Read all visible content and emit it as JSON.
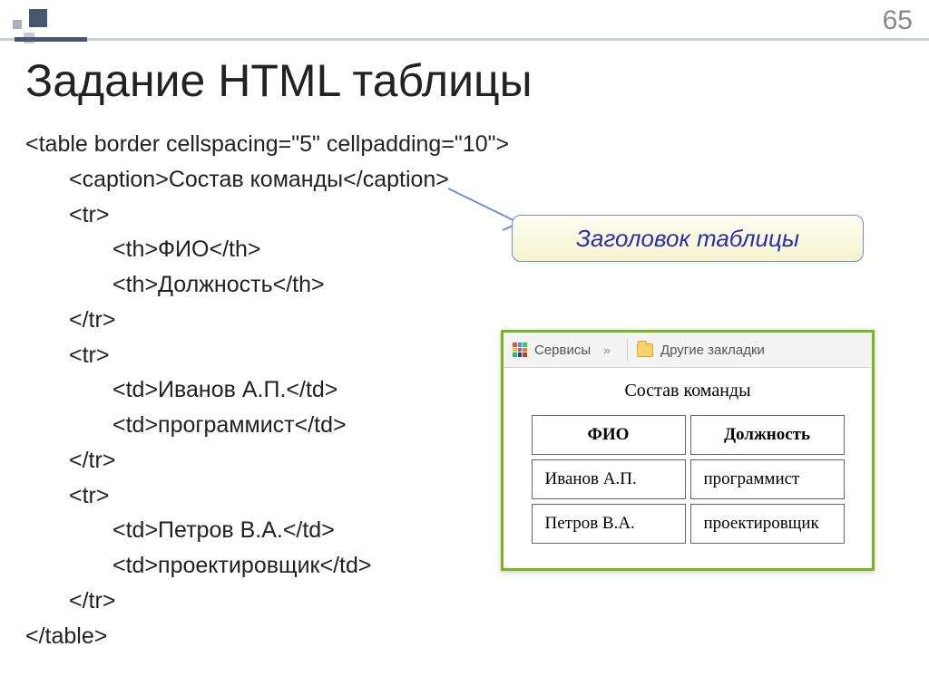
{
  "page_number": "65",
  "title": "Задание HTML таблицы",
  "code": {
    "l1": "<table border cellspacing=\"5\" cellpadding=\"10\">",
    "l2": "<caption>Состав команды</caption>",
    "l3": "<tr>",
    "l4": "<th>ФИО</th>",
    "l5": "<th>Должность</th>",
    "l6": "</tr>",
    "l7": "<tr>",
    "l8": "<td>Иванов А.П.</td>",
    "l9": "<td>программист</td>",
    "l10": "</tr>",
    "l11": "<tr>",
    "l12": "<td>Петров В.А.</td>",
    "l13": "<td>проектировщик</td>",
    "l14": "</tr>",
    "l15": "</table>"
  },
  "callout": "Заголовок таблицы",
  "toolbar": {
    "services": "Сервисы",
    "chevron": "»",
    "other_bookmarks": "Другие закладки"
  },
  "table": {
    "caption": "Состав команды",
    "headers": [
      "ФИО",
      "Должность"
    ],
    "rows": [
      [
        "Иванов А.П.",
        "программист"
      ],
      [
        "Петров В.А.",
        "проектировщик"
      ]
    ]
  }
}
